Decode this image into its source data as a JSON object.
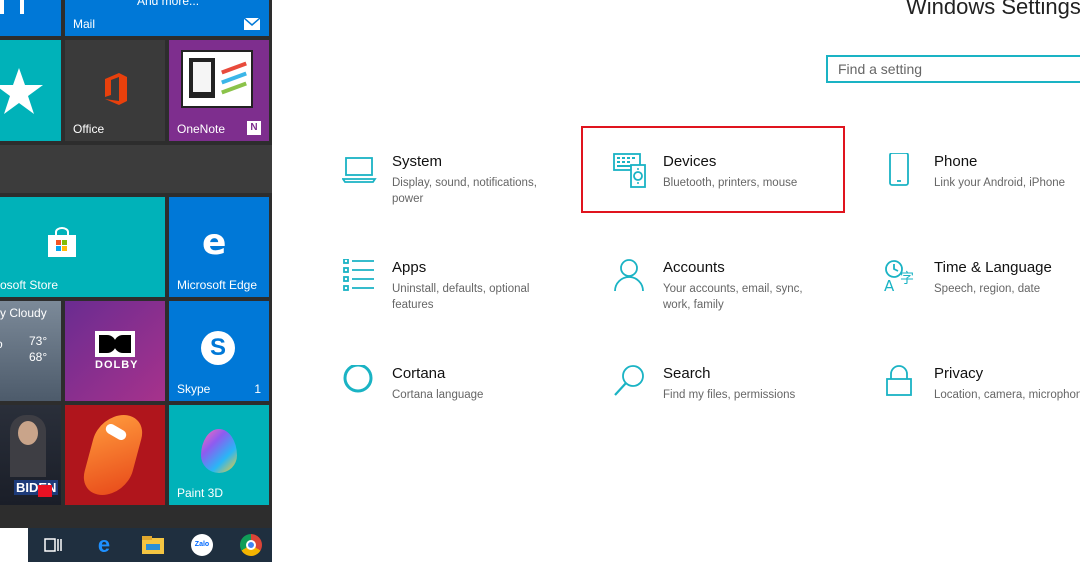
{
  "start_menu": {
    "tiles": {
      "mail": {
        "label": "Mail",
        "top_text": "And more..."
      },
      "office": {
        "label": "Office"
      },
      "onenote": {
        "label": "OneNote"
      },
      "store": {
        "label": "osoft Store"
      },
      "edge": {
        "label": "Microsoft Edge"
      },
      "weather": {
        "condition": "y Cloudy",
        "high": "73°",
        "low": "68°"
      },
      "dolby": {
        "label": "DOLBY"
      },
      "skype": {
        "label": "Skype",
        "badge": "1"
      },
      "news": {
        "caption": "BIDEN"
      },
      "paint3d": {
        "label": "Paint 3D"
      }
    }
  },
  "taskbar": {
    "icons": [
      "task-view-icon",
      "edge-icon",
      "file-explorer-icon",
      "zalo-icon",
      "chrome-icon"
    ],
    "zalo_text": "Zalo"
  },
  "settings": {
    "title": "Windows Settings",
    "search": {
      "placeholder": "Find a setting"
    },
    "items": [
      {
        "name": "System",
        "desc": "Display, sound, notifications, power",
        "icon": "laptop-icon"
      },
      {
        "name": "Devices",
        "desc": "Bluetooth, printers, mouse",
        "icon": "devices-icon"
      },
      {
        "name": "Phone",
        "desc": "Link your Android, iPhone",
        "icon": "phone-icon"
      },
      {
        "name": "Apps",
        "desc": "Uninstall, defaults, optional features",
        "icon": "apps-list-icon"
      },
      {
        "name": "Accounts",
        "desc": "Your accounts, email, sync, work, family",
        "icon": "person-icon"
      },
      {
        "name": "Time & Language",
        "desc": "Speech, region, date",
        "icon": "time-language-icon"
      },
      {
        "name": "Cortana",
        "desc": "Cortana language",
        "icon": "cortana-circle-icon"
      },
      {
        "name": "Search",
        "desc": "Find my files, permissions",
        "icon": "magnifier-icon"
      },
      {
        "name": "Privacy",
        "desc": "Location, camera, microphone",
        "icon": "lock-icon"
      }
    ],
    "accent_color": "#1ab3c4",
    "highlight_color": "#e0141e"
  }
}
